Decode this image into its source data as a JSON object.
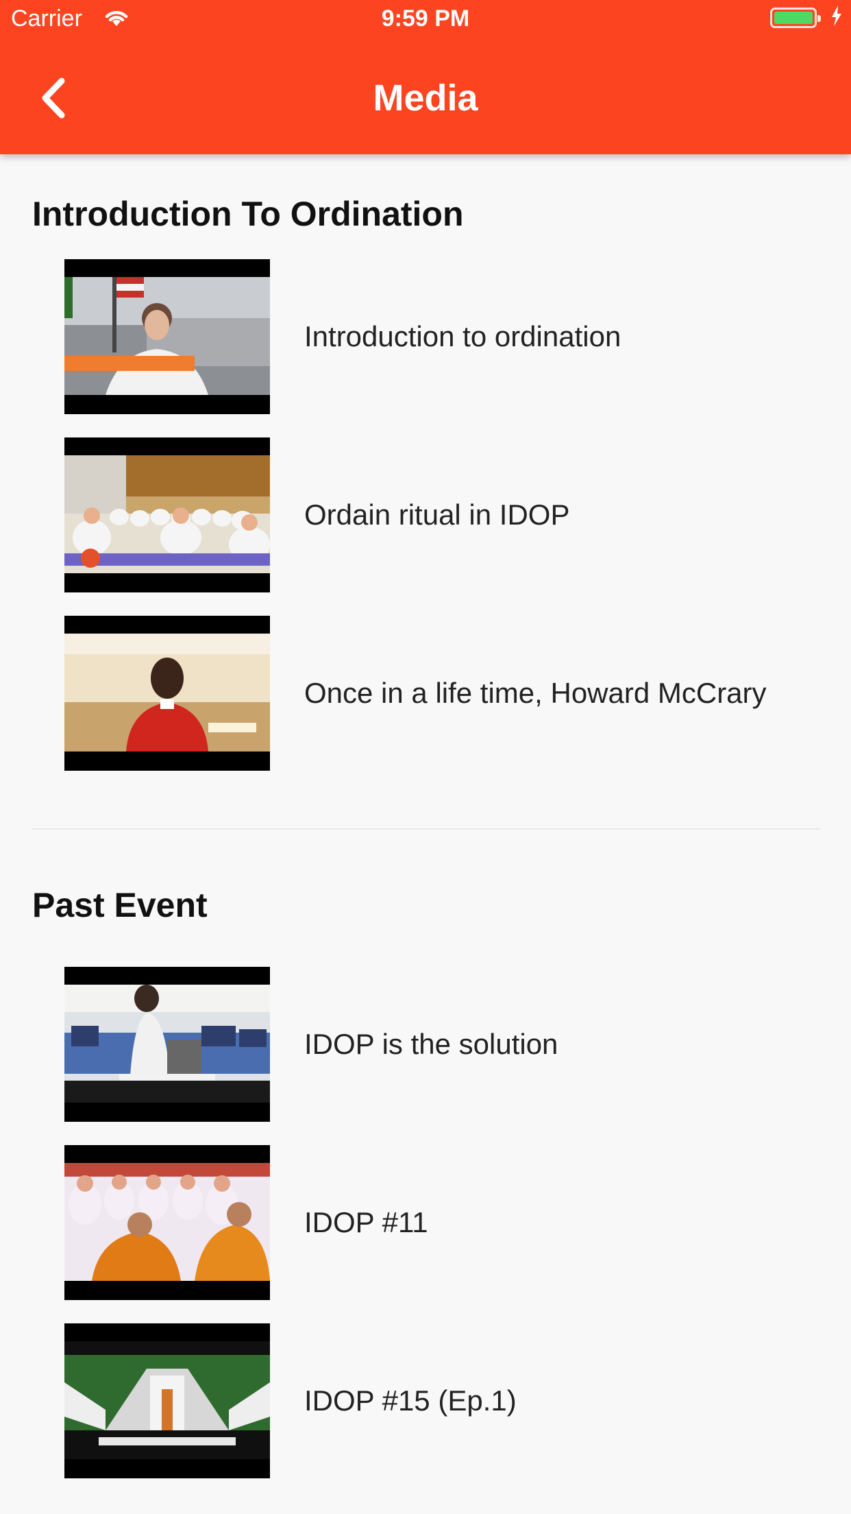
{
  "status_bar": {
    "carrier": "Carrier",
    "time": "9:59 PM",
    "battery_level": 1.0,
    "battery_color": "#4cd964"
  },
  "app_bar": {
    "title": "Media",
    "back_icon": "chevron-left-icon",
    "color": "#fc4420"
  },
  "sections": [
    {
      "title": "Introduction To Ordination",
      "items": [
        {
          "label": "Introduction to ordination"
        },
        {
          "label": "Ordain ritual in IDOP"
        },
        {
          "label": "Once in a life time, Howard McCrary"
        }
      ]
    },
    {
      "title": "Past Event",
      "items": [
        {
          "label": "IDOP is the solution"
        },
        {
          "label": "IDOP #11"
        },
        {
          "label": "IDOP #15 (Ep.1)"
        }
      ]
    }
  ]
}
